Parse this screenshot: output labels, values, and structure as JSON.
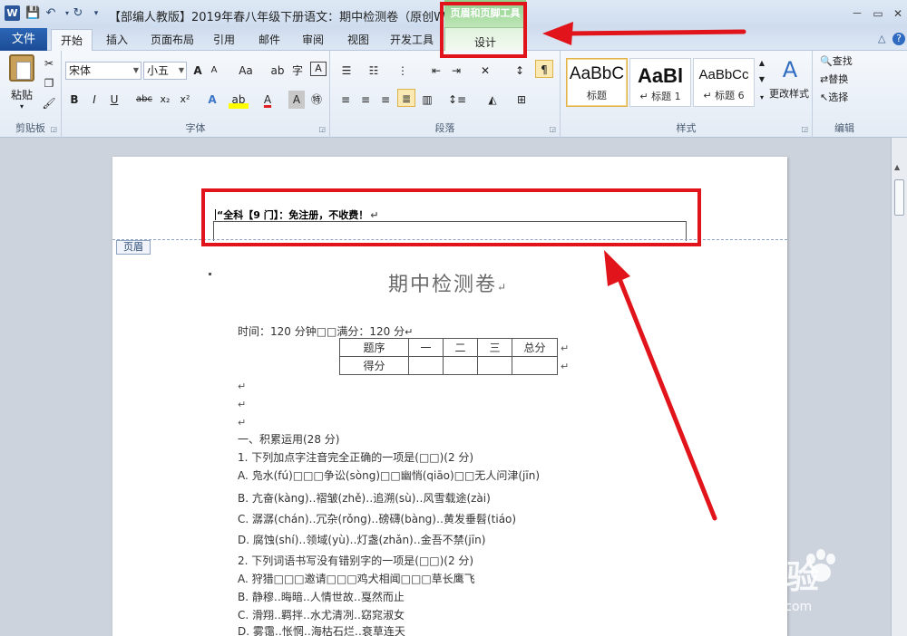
{
  "titlebar": {
    "logo": "W",
    "doc_title": "【部编人教版】2019年春八年级下册语文：期中检测卷（原创W...",
    "context_group": "页眉和页脚工具",
    "window_buttons": [
      "－",
      "▭",
      "✕"
    ]
  },
  "tabs": {
    "file": "文件",
    "items": [
      "开始",
      "插入",
      "页面布局",
      "引用",
      "邮件",
      "审阅",
      "视图",
      "开发工具"
    ],
    "design": "设计"
  },
  "ribbon": {
    "clipboard": {
      "paste": "粘贴",
      "label": "剪贴板"
    },
    "font": {
      "font_name": "宋体",
      "font_size": "小五",
      "grow": "A",
      "shrink": "A",
      "change_case": "Aa",
      "bold": "B",
      "italic": "I",
      "underline": "U",
      "strike": "abc",
      "subscript": "x₂",
      "superscript": "x²",
      "font_color": "A",
      "label": "字体"
    },
    "paragraph": {
      "label": "段落"
    },
    "styles": {
      "items": [
        {
          "sample": "AaBbC",
          "name": "标题"
        },
        {
          "sample": "AaBl",
          "name": "↵ 标题 1"
        },
        {
          "sample": "AaBbCc",
          "name": "↵ 标题 6"
        }
      ],
      "change_styles": "更改样式",
      "label": "样式"
    },
    "editing": {
      "find": "查找",
      "replace": "替换",
      "select": "选择",
      "label": "编辑"
    }
  },
  "document": {
    "header_text": "“全科【9 门】：免注册，不收费！",
    "header_tag": "页眉",
    "title": "期中检测卷",
    "meta": "时间：120 分钟□□满分：120 分",
    "score_table": {
      "row1": [
        "题序",
        "一",
        "二",
        "三",
        "总分"
      ],
      "row2": [
        "得分",
        "",
        "",
        "",
        ""
      ]
    },
    "lines": [
      "一、积累运用(28 分)",
      "1.  下列加点字注音完全正确的一项是(□□)(2 分)",
      "A.  凫水(fú)□□□争讼(sòng)□□幽悄(qiāo)□□无人问津(jīn)",
      "B.  亢奋(kàng)‥褶皱(zhě)‥追溯(sù)‥风雪载途(zài)",
      "C.  潺潺(chán)‥冗杂(rǒng)‥磅礴(bàng)‥黄发垂髫(tiáo)",
      "D.  腐蚀(shí)‥领域(yù)‥灯盏(zhǎn)‥金吾不禁(jīn)",
      "2.  下列词语书写没有错别字的一项是(□□)(2 分)",
      "A.  狩猎□□□邀请□□□鸡犬相闻□□□草长鹰飞",
      "B.  静穆‥晦暗‥人情世故‥戛然而止",
      "C.  滑翔‥羁拌‥水尤清冽‥窈窕淑女",
      "D.  雾霭‥怅惘‥海枯石烂‥衰草连天"
    ]
  },
  "watermark": {
    "logo": "Bai 经验",
    "url": "jingyan.baidu.com"
  },
  "colors": {
    "annotation_red": "#e0141a",
    "file_tab": "#1b4c95",
    "context_green": "#8fd18b"
  }
}
